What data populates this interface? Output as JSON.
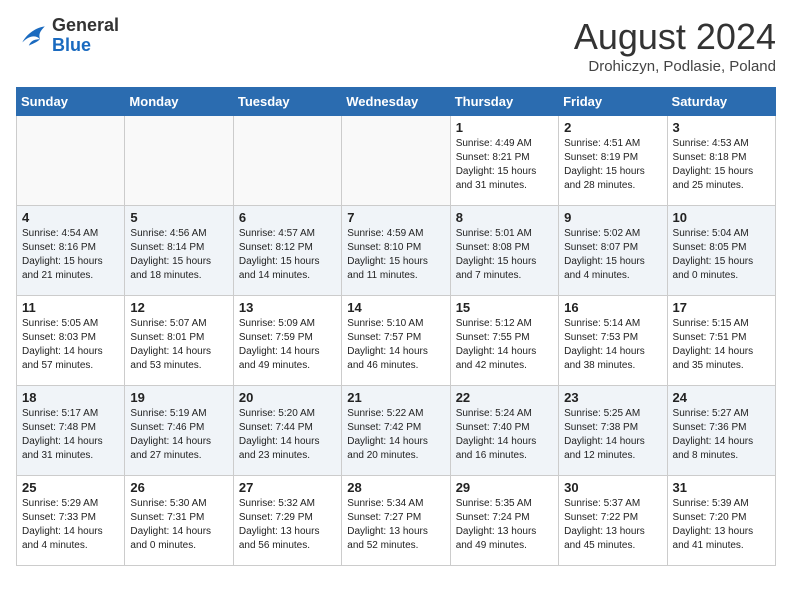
{
  "header": {
    "logo_line1": "General",
    "logo_line2": "Blue",
    "month": "August 2024",
    "location": "Drohiczyn, Podlasie, Poland"
  },
  "weekdays": [
    "Sunday",
    "Monday",
    "Tuesday",
    "Wednesday",
    "Thursday",
    "Friday",
    "Saturday"
  ],
  "weeks": [
    [
      {
        "day": "",
        "text": ""
      },
      {
        "day": "",
        "text": ""
      },
      {
        "day": "",
        "text": ""
      },
      {
        "day": "",
        "text": ""
      },
      {
        "day": "1",
        "text": "Sunrise: 4:49 AM\nSunset: 8:21 PM\nDaylight: 15 hours\nand 31 minutes."
      },
      {
        "day": "2",
        "text": "Sunrise: 4:51 AM\nSunset: 8:19 PM\nDaylight: 15 hours\nand 28 minutes."
      },
      {
        "day": "3",
        "text": "Sunrise: 4:53 AM\nSunset: 8:18 PM\nDaylight: 15 hours\nand 25 minutes."
      }
    ],
    [
      {
        "day": "4",
        "text": "Sunrise: 4:54 AM\nSunset: 8:16 PM\nDaylight: 15 hours\nand 21 minutes."
      },
      {
        "day": "5",
        "text": "Sunrise: 4:56 AM\nSunset: 8:14 PM\nDaylight: 15 hours\nand 18 minutes."
      },
      {
        "day": "6",
        "text": "Sunrise: 4:57 AM\nSunset: 8:12 PM\nDaylight: 15 hours\nand 14 minutes."
      },
      {
        "day": "7",
        "text": "Sunrise: 4:59 AM\nSunset: 8:10 PM\nDaylight: 15 hours\nand 11 minutes."
      },
      {
        "day": "8",
        "text": "Sunrise: 5:01 AM\nSunset: 8:08 PM\nDaylight: 15 hours\nand 7 minutes."
      },
      {
        "day": "9",
        "text": "Sunrise: 5:02 AM\nSunset: 8:07 PM\nDaylight: 15 hours\nand 4 minutes."
      },
      {
        "day": "10",
        "text": "Sunrise: 5:04 AM\nSunset: 8:05 PM\nDaylight: 15 hours\nand 0 minutes."
      }
    ],
    [
      {
        "day": "11",
        "text": "Sunrise: 5:05 AM\nSunset: 8:03 PM\nDaylight: 14 hours\nand 57 minutes."
      },
      {
        "day": "12",
        "text": "Sunrise: 5:07 AM\nSunset: 8:01 PM\nDaylight: 14 hours\nand 53 minutes."
      },
      {
        "day": "13",
        "text": "Sunrise: 5:09 AM\nSunset: 7:59 PM\nDaylight: 14 hours\nand 49 minutes."
      },
      {
        "day": "14",
        "text": "Sunrise: 5:10 AM\nSunset: 7:57 PM\nDaylight: 14 hours\nand 46 minutes."
      },
      {
        "day": "15",
        "text": "Sunrise: 5:12 AM\nSunset: 7:55 PM\nDaylight: 14 hours\nand 42 minutes."
      },
      {
        "day": "16",
        "text": "Sunrise: 5:14 AM\nSunset: 7:53 PM\nDaylight: 14 hours\nand 38 minutes."
      },
      {
        "day": "17",
        "text": "Sunrise: 5:15 AM\nSunset: 7:51 PM\nDaylight: 14 hours\nand 35 minutes."
      }
    ],
    [
      {
        "day": "18",
        "text": "Sunrise: 5:17 AM\nSunset: 7:48 PM\nDaylight: 14 hours\nand 31 minutes."
      },
      {
        "day": "19",
        "text": "Sunrise: 5:19 AM\nSunset: 7:46 PM\nDaylight: 14 hours\nand 27 minutes."
      },
      {
        "day": "20",
        "text": "Sunrise: 5:20 AM\nSunset: 7:44 PM\nDaylight: 14 hours\nand 23 minutes."
      },
      {
        "day": "21",
        "text": "Sunrise: 5:22 AM\nSunset: 7:42 PM\nDaylight: 14 hours\nand 20 minutes."
      },
      {
        "day": "22",
        "text": "Sunrise: 5:24 AM\nSunset: 7:40 PM\nDaylight: 14 hours\nand 16 minutes."
      },
      {
        "day": "23",
        "text": "Sunrise: 5:25 AM\nSunset: 7:38 PM\nDaylight: 14 hours\nand 12 minutes."
      },
      {
        "day": "24",
        "text": "Sunrise: 5:27 AM\nSunset: 7:36 PM\nDaylight: 14 hours\nand 8 minutes."
      }
    ],
    [
      {
        "day": "25",
        "text": "Sunrise: 5:29 AM\nSunset: 7:33 PM\nDaylight: 14 hours\nand 4 minutes."
      },
      {
        "day": "26",
        "text": "Sunrise: 5:30 AM\nSunset: 7:31 PM\nDaylight: 14 hours\nand 0 minutes."
      },
      {
        "day": "27",
        "text": "Sunrise: 5:32 AM\nSunset: 7:29 PM\nDaylight: 13 hours\nand 56 minutes."
      },
      {
        "day": "28",
        "text": "Sunrise: 5:34 AM\nSunset: 7:27 PM\nDaylight: 13 hours\nand 52 minutes."
      },
      {
        "day": "29",
        "text": "Sunrise: 5:35 AM\nSunset: 7:24 PM\nDaylight: 13 hours\nand 49 minutes."
      },
      {
        "day": "30",
        "text": "Sunrise: 5:37 AM\nSunset: 7:22 PM\nDaylight: 13 hours\nand 45 minutes."
      },
      {
        "day": "31",
        "text": "Sunrise: 5:39 AM\nSunset: 7:20 PM\nDaylight: 13 hours\nand 41 minutes."
      }
    ]
  ]
}
